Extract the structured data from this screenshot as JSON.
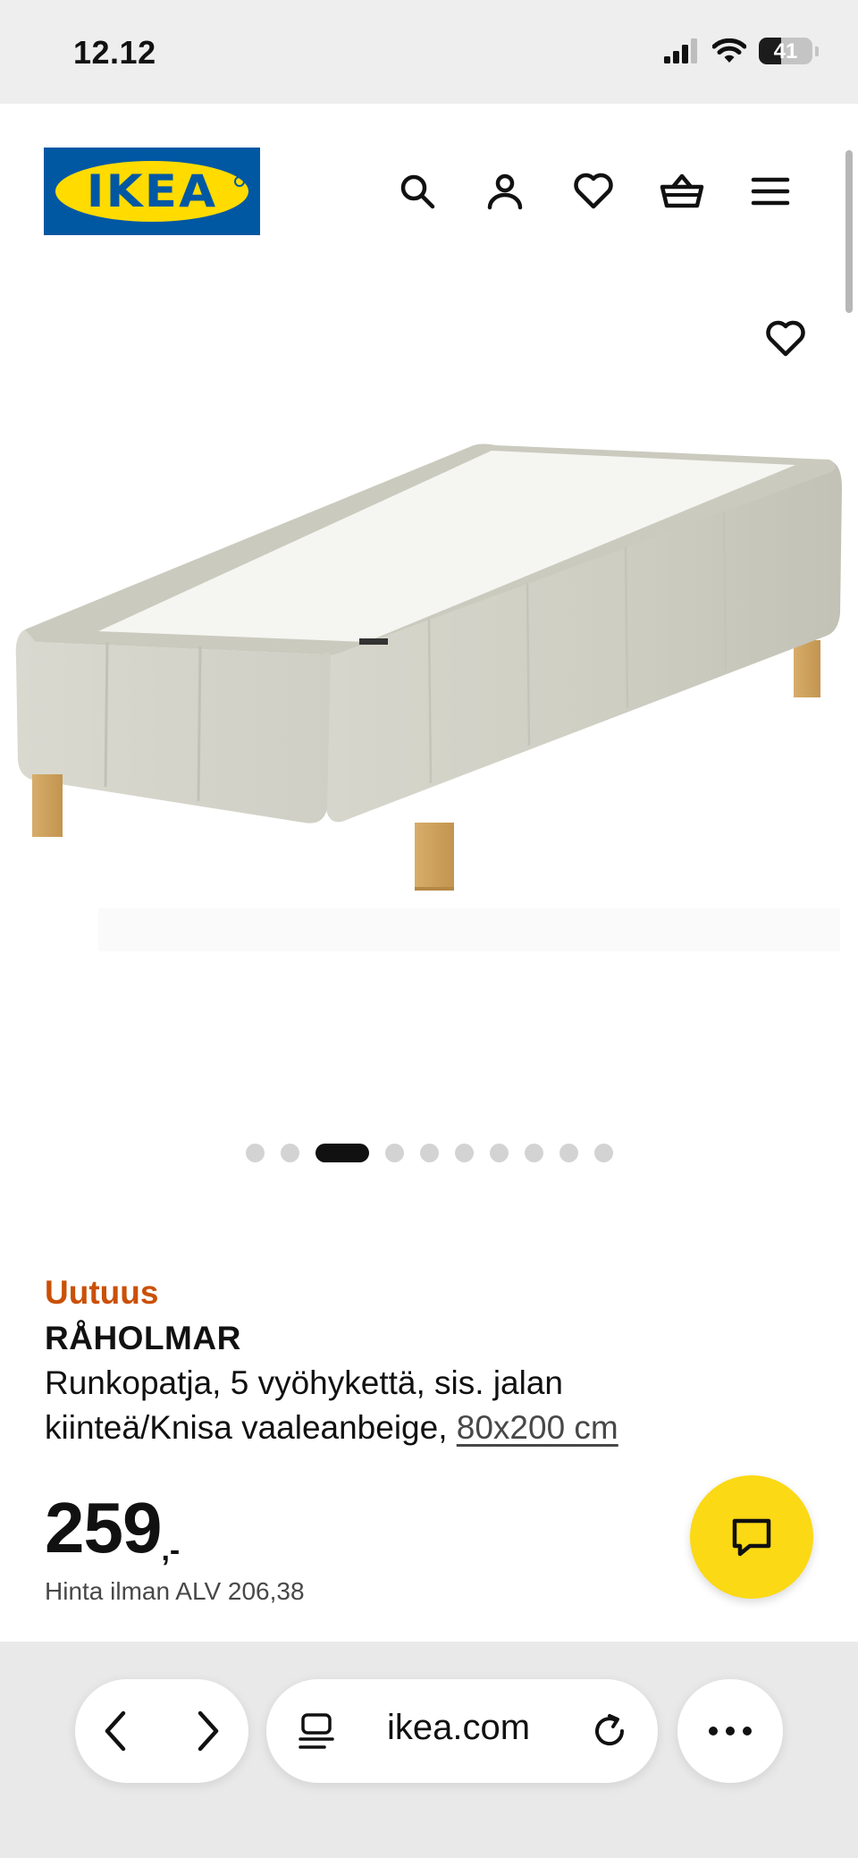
{
  "status_bar": {
    "time": "12.12",
    "battery": "41",
    "battery_level": 0.41
  },
  "header": {
    "logo_text": "IKEA",
    "icons": [
      "search-icon",
      "profile-icon",
      "heart-icon",
      "basket-icon",
      "menu-icon"
    ]
  },
  "gallery": {
    "favorite_icon": "heart-icon",
    "image_count": 10,
    "active_index": 2
  },
  "product": {
    "badge": "Uutuus",
    "name": "RÅHOLMAR",
    "description": "Runkopatja, 5 vyöhykettä, sis. jalan kiinteä/Knisa vaaleanbeige, ",
    "size": "80x200 cm",
    "price": "259",
    "price_suffix": ",-",
    "price_without_vat": "Hinta ilman ALV 206,38"
  },
  "chat": {
    "icon": "chat-icon"
  },
  "browser": {
    "url": "ikea.com",
    "icons": [
      "back-icon",
      "forward-icon",
      "tabs-icon",
      "reload-icon",
      "more-icon"
    ]
  },
  "colors": {
    "ikea_blue": "#0058a3",
    "ikea_yellow": "#ffdb00",
    "badge_orange": "#ca5008",
    "chat_yellow": "#fbd914"
  }
}
